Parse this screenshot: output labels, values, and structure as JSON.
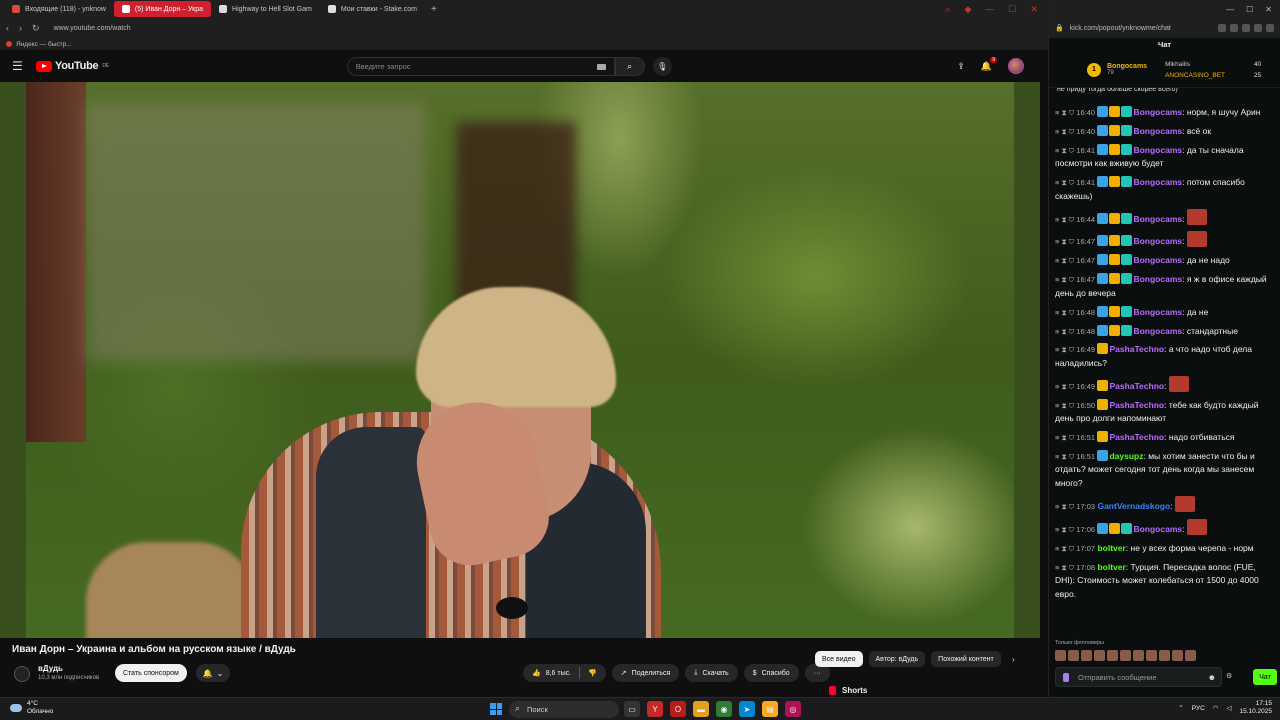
{
  "left_browser": {
    "tabs": [
      {
        "title": "Входящие (118) - ynknow",
        "color": "#e0483a",
        "active": false
      },
      {
        "title": "(5) Иван Дорн – Укра",
        "color": "#ffffff",
        "active": true
      },
      {
        "title": "Highway to Hell Slot Gam",
        "color": "#e6e6e6",
        "active": false
      },
      {
        "title": "Мои ставки - Stake.com",
        "color": "#e6e6e6",
        "active": false
      }
    ],
    "new_tab": "+",
    "url": "www.youtube.com/watch",
    "bookmark": "Яндекс — быстр..."
  },
  "youtube": {
    "logo_text": "YouTube",
    "logo_region": "DE",
    "search_placeholder": "Введите запрос",
    "notification_count": "9",
    "video": {
      "title": "Иван Дорн – Украина и альбом на русском языке / вДудь",
      "channel": "вДудь",
      "subscribers": "10,3 млн подписчиков",
      "sponsor_label": "Стать спонсором",
      "likes": "8,6 тыс.",
      "share_label": "Поделиться",
      "download_label": "Скачать",
      "thanks_label": "Спасибо",
      "more": "···"
    },
    "chips": [
      "Все видео",
      "Автор: вДудь",
      "Похожий контент"
    ],
    "shorts_label": "Shorts"
  },
  "chat_browser": {
    "url": "kick.com/popout/ynknowme/chat",
    "chat_title": "Чат",
    "pinned": {
      "top_user": "Bongocams",
      "top_value": "79",
      "rank1_user": "Mikhailis",
      "rank1_value": "40",
      "rank2_user": "ANONCASINO_BET",
      "rank2_value": "25"
    },
    "cutoff_text": "не приду тогда больше скорее всего)",
    "messages": [
      {
        "time": "16:40",
        "badges": [
          "b-blue",
          "b-gold",
          "b-teal"
        ],
        "user": "Bongocams",
        "user_class": "u-purple",
        "text": "норм, я шучу Арин",
        "emote": false
      },
      {
        "time": "16:40",
        "badges": [
          "b-blue",
          "b-gold",
          "b-teal"
        ],
        "user": "Bongocams",
        "user_class": "u-purple",
        "text": "всё ок",
        "emote": false
      },
      {
        "time": "16:41",
        "badges": [
          "b-blue",
          "b-gold",
          "b-teal"
        ],
        "user": "Bongocams",
        "user_class": "u-purple",
        "text": "да ты сначала посмотри как вживую будет",
        "emote": false
      },
      {
        "time": "16:41",
        "badges": [
          "b-blue",
          "b-gold",
          "b-teal"
        ],
        "user": "Bongocams",
        "user_class": "u-purple",
        "text": "потом спасибо скажешь)",
        "emote": false
      },
      {
        "time": "16:44",
        "badges": [
          "b-blue",
          "b-gold",
          "b-teal"
        ],
        "user": "Bongocams",
        "user_class": "u-purple",
        "text": "",
        "emote": true
      },
      {
        "time": "16:47",
        "badges": [
          "b-blue",
          "b-gold",
          "b-teal"
        ],
        "user": "Bongocams",
        "user_class": "u-purple",
        "text": "",
        "emote": true
      },
      {
        "time": "16:47",
        "badges": [
          "b-blue",
          "b-gold",
          "b-teal"
        ],
        "user": "Bongocams",
        "user_class": "u-purple",
        "text": "да не надо",
        "emote": false
      },
      {
        "time": "16:47",
        "badges": [
          "b-blue",
          "b-gold",
          "b-teal"
        ],
        "user": "Bongocams",
        "user_class": "u-purple",
        "text": "я ж в офисе каждый день до вечера",
        "emote": false
      },
      {
        "time": "16:48",
        "badges": [
          "b-blue",
          "b-gold",
          "b-teal"
        ],
        "user": "Bongocams",
        "user_class": "u-purple",
        "text": "да не",
        "emote": false
      },
      {
        "time": "16:48",
        "badges": [
          "b-blue",
          "b-gold",
          "b-teal"
        ],
        "user": "Bongocams",
        "user_class": "u-purple",
        "text": "стандартные",
        "emote": false
      },
      {
        "time": "16:49",
        "badges": [
          "b-gold"
        ],
        "user": "PashaTechno",
        "user_class": "u-purple",
        "text": "а что надо чтоб дела наладились?",
        "emote": false
      },
      {
        "time": "16:49",
        "badges": [
          "b-gold"
        ],
        "user": "PashaTechno",
        "user_class": "u-purple",
        "text": "",
        "emote": true
      },
      {
        "time": "16:50",
        "badges": [
          "b-gold"
        ],
        "user": "PashaTechno",
        "user_class": "u-purple",
        "text": "тебе как будто каждый день про долги напоминают",
        "emote": false
      },
      {
        "time": "16:51",
        "badges": [
          "b-gold"
        ],
        "user": "PashaTechno",
        "user_class": "u-purple",
        "text": "надо отбиваться",
        "emote": false
      },
      {
        "time": "16:51",
        "badges": [
          "b-blue"
        ],
        "user": "daysupz",
        "user_class": "u-green",
        "text": "мы хотим занести что бы и отдать? может сегодня тот день когда мы занесем много?",
        "emote": false
      },
      {
        "time": "17:03",
        "badges": [],
        "user": "GantVernadskogo",
        "user_class": "u-blue",
        "text": "",
        "emote": true
      },
      {
        "time": "17:06",
        "badges": [
          "b-blue",
          "b-gold",
          "b-teal"
        ],
        "user": "Bongocams",
        "user_class": "u-purple",
        "text": "",
        "emote": true
      },
      {
        "time": "17:07",
        "badges": [],
        "user": "boltver",
        "user_class": "u-green",
        "text": "не у всех форма черепа - норм",
        "emote": false
      },
      {
        "time": "17:08",
        "badges": [],
        "user": "boltver",
        "user_class": "u-green",
        "text": "Турция. Пересадка волос (FUE, DHI): Стоимость может колебаться от 1500 до 4000 евро.",
        "emote": false
      }
    ],
    "followers_only": "Только фолловеры",
    "input_placeholder": "Отправить сообщение",
    "send_label": "Чат"
  },
  "taskbar": {
    "temperature": "4°C",
    "weather": "Облачно",
    "search_label": "Поиск",
    "language": "РУС",
    "time": "17:15",
    "date": "15.10.2025"
  },
  "colors": {
    "youtube_red": "#ff0000",
    "kick_green": "#53fc18",
    "active_tab": "#d01f2f"
  }
}
